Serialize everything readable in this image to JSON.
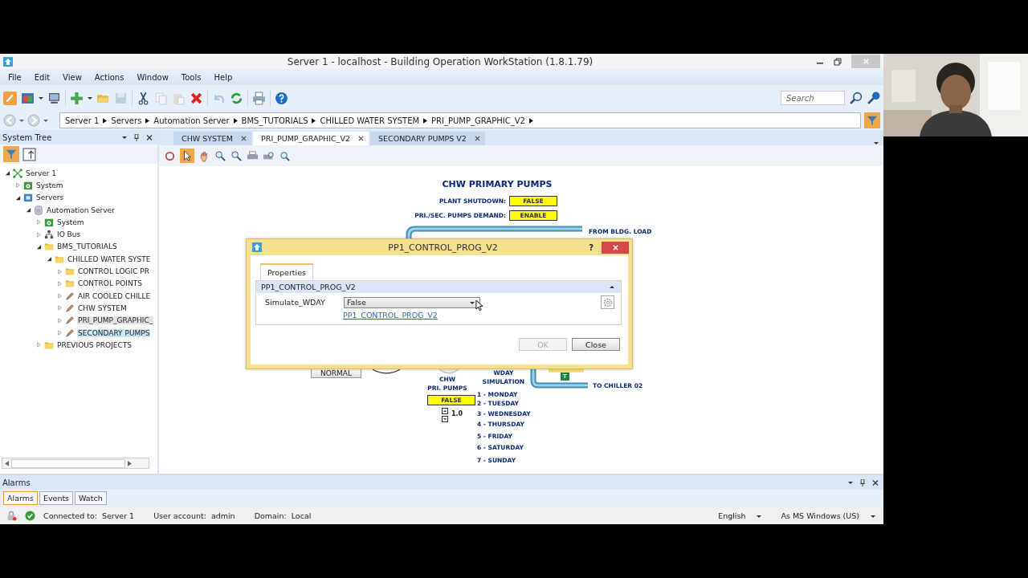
{
  "window": {
    "title": "Server 1 - localhost - Building Operation WorkStation (1.8.1.79)"
  },
  "menu": [
    "File",
    "Edit",
    "View",
    "Actions",
    "Window",
    "Tools",
    "Help"
  ],
  "search": {
    "placeholder": "Search"
  },
  "breadcrumb": [
    "Server 1",
    "Servers",
    "Automation Server",
    "BMS_TUTORIALS",
    "CHILLED WATER SYSTEM",
    "PRI_PUMP_GRAPHIC_V2"
  ],
  "tree": {
    "title": "System Tree",
    "items": [
      {
        "label": "Server 1",
        "kind": "server",
        "expanded": true,
        "selected": false,
        "open": false,
        "children": [
          {
            "label": "System",
            "kind": "system",
            "expanded": false,
            "selected": false,
            "open": false
          },
          {
            "label": "Servers",
            "kind": "servers",
            "expanded": true,
            "selected": false,
            "open": false,
            "children": [
              {
                "label": "Automation Server",
                "kind": "automation",
                "expanded": true,
                "selected": false,
                "open": false,
                "children": [
                  {
                    "label": "System",
                    "kind": "system",
                    "expanded": false,
                    "selected": false,
                    "open": false
                  },
                  {
                    "label": "IO Bus",
                    "kind": "iobus",
                    "expanded": false,
                    "selected": false,
                    "open": false
                  },
                  {
                    "label": "BMS_TUTORIALS",
                    "kind": "folder",
                    "expanded": true,
                    "selected": false,
                    "open": false,
                    "children": [
                      {
                        "label": "CHILLED WATER SYSTE",
                        "kind": "folder",
                        "expanded": true,
                        "selected": false,
                        "open": false,
                        "children": [
                          {
                            "label": "CONTROL LOGIC PR",
                            "kind": "folder",
                            "expanded": false,
                            "selected": false,
                            "open": false
                          },
                          {
                            "label": "CONTROL POINTS",
                            "kind": "folder",
                            "expanded": false,
                            "selected": false,
                            "open": false
                          },
                          {
                            "label": "AIR COOLED CHILLE",
                            "kind": "graphic",
                            "expanded": false,
                            "selected": false,
                            "open": false
                          },
                          {
                            "label": "CHW SYSTEM",
                            "kind": "graphic",
                            "expanded": false,
                            "selected": false,
                            "open": false
                          },
                          {
                            "label": "PRI_PUMP_GRAPHIC_",
                            "kind": "graphic",
                            "expanded": false,
                            "selected": false,
                            "open": true
                          },
                          {
                            "label": "SECONDARY PUMPS",
                            "kind": "graphic",
                            "expanded": false,
                            "selected": true,
                            "open": false
                          }
                        ]
                      }
                    ]
                  },
                  {
                    "label": "PREVIOUS PROJECTS",
                    "kind": "folder",
                    "expanded": false,
                    "selected": false,
                    "open": false
                  }
                ]
              }
            ]
          }
        ]
      }
    ]
  },
  "tabs": [
    {
      "label": "CHW SYSTEM",
      "selected": false
    },
    {
      "label": "PRI_PUMP_GRAPHIC_V2",
      "selected": true
    },
    {
      "label": "SECONDARY PUMPS V2",
      "selected": false
    }
  ],
  "graphic": {
    "title": "CHW PRIMARY PUMPS",
    "status_rows": [
      {
        "label": "PLANT SHUTDOWN:",
        "value": "FALSE"
      },
      {
        "label": "PRI./SEC. PUMPS DEMAND:",
        "value": "ENABLE"
      }
    ],
    "inlet_label": "FROM BLDG. LOAD",
    "outlet_label": "TO CHILLER 02",
    "mode_button": "NORMAL",
    "pump_label_lines": [
      "CHW",
      "PRI. PUMPS"
    ],
    "pump_value": "FALSE",
    "pump_speed": "1.0",
    "valve_tag": "T",
    "simulation_lines": [
      "WDAY",
      "SIMULATION"
    ],
    "days": [
      "1 - MONDAY",
      "2 - TUESDAY",
      "3 - WEDNESDAY",
      "4 - THURSDAY",
      "5 - FRIDAY",
      "6 - SATURDAY",
      "7 - SUNDAY"
    ]
  },
  "dialog": {
    "title": "PP1_CONTROL_PROG_V2",
    "help": "?",
    "tabs": [
      {
        "label": "Properties",
        "selected": true
      }
    ],
    "section": "PP1_CONTROL_PROG_V2",
    "property": {
      "name": "Simulate_WDAY",
      "value": "False"
    },
    "link": "PP1_CONTROL_PROG_V2",
    "buttons": [
      {
        "label": "OK",
        "disabled": true
      },
      {
        "label": "Close",
        "disabled": false
      }
    ]
  },
  "alarms": {
    "title": "Alarms",
    "tabs": [
      {
        "label": "Alarms",
        "selected": true
      },
      {
        "label": "Events",
        "selected": false
      },
      {
        "label": "Watch",
        "selected": false
      }
    ]
  },
  "status_bar": {
    "items": [
      {
        "label": "Connected to:",
        "value": "Server 1"
      },
      {
        "label": "User account:",
        "value": "admin"
      },
      {
        "label": "Domain:",
        "value": "Local"
      }
    ],
    "language": "English",
    "format": "As MS Windows (US)"
  }
}
